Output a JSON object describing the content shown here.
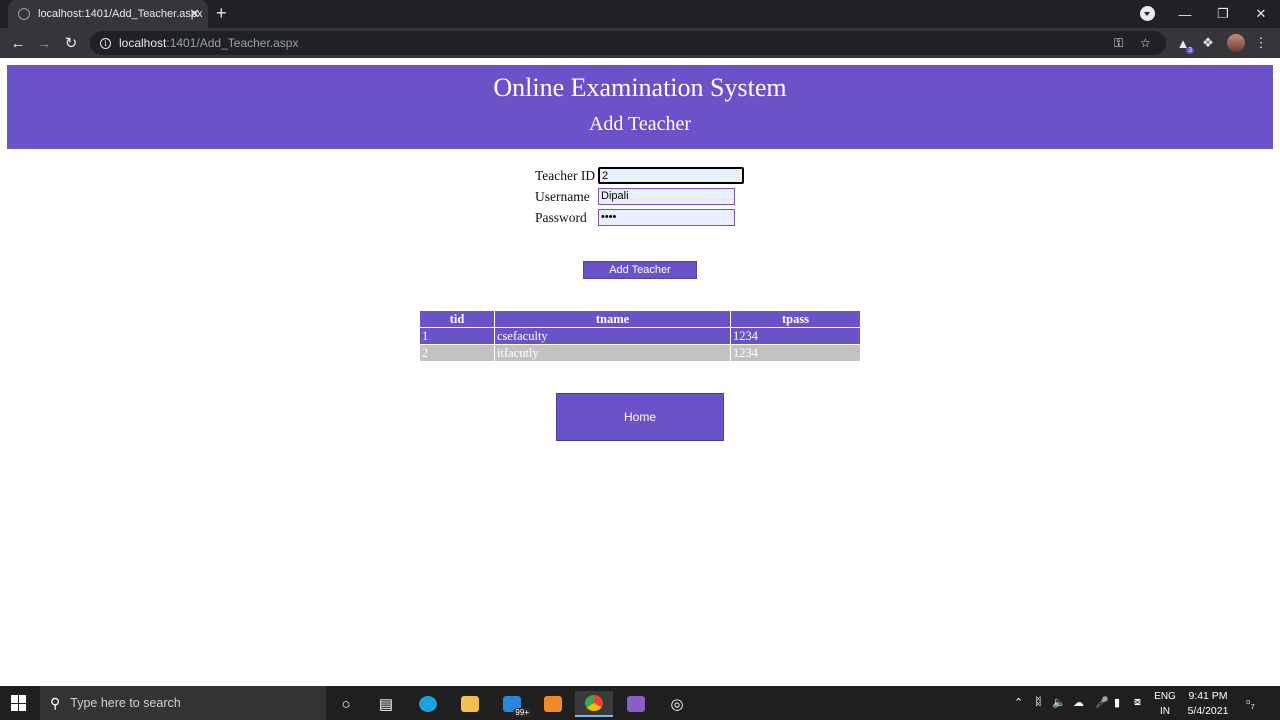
{
  "browser": {
    "tab_title": "localhost:1401/Add_Teacher.aspx",
    "tab_close": "✕",
    "new_tab": "+",
    "url_host": "localhost",
    "url_path": ":1401/Add_Teacher.aspx",
    "ext_badge": "3"
  },
  "page": {
    "title": "Online Examination System",
    "subtitle": "Add Teacher",
    "form": {
      "teacher_id_label": "Teacher ID",
      "teacher_id_value": "2",
      "username_label": "Username",
      "username_value": "Dipali",
      "password_label": "Password",
      "password_value": "••••",
      "add_button": "Add Teacher"
    },
    "table": {
      "columns": [
        "tid",
        "tname",
        "tpass"
      ],
      "rows": [
        [
          "1",
          "csefaculty",
          "1234"
        ],
        [
          "2",
          "itfacutly",
          "1234"
        ]
      ]
    },
    "home_button": "Home"
  },
  "taskbar": {
    "search_placeholder": "Type here to search",
    "mail_badge": "99+",
    "lang_line1": "ENG",
    "lang_line2": "IN",
    "time": "9:41 PM",
    "date": "5/4/2021",
    "notif_count": "7"
  },
  "colors": {
    "accent": "#6a52c8",
    "row_alt": "#c2c2c2"
  }
}
